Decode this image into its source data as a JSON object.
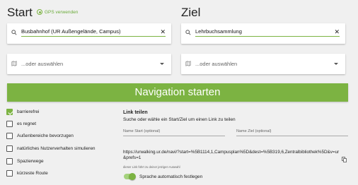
{
  "start": {
    "title": "Start",
    "gps_label": "GPS verwenden",
    "search_value": "Busbahnhof (UR Außengelände, Campus)",
    "search_clear": "✕",
    "select_value": "...oder auswählen"
  },
  "ziel": {
    "title": "Ziel",
    "search_value": "Lehrbuchsammlung",
    "search_clear": "✕",
    "select_value": "...oder auswählen"
  },
  "navigation_button": "Navigation starten",
  "options": [
    {
      "label": "barrierefrei",
      "checked": true
    },
    {
      "label": "es regnet",
      "checked": false
    },
    {
      "label": "Außenbereiche bevorzugen",
      "checked": false
    },
    {
      "label": "natürliches Nutzerverhalten simulieren",
      "checked": false
    },
    {
      "label": "Spazierwege",
      "checked": false
    },
    {
      "label": "kürzeste Route",
      "checked": false
    }
  ],
  "share": {
    "title": "Link teilen",
    "subtitle": "Suche oder wähle ein Start/Ziel um einen Link zu teilen",
    "name_start_placeholder": "Name Start (optional)",
    "name_ziel_placeholder": "Name Ziel (optional)",
    "link": "https://urwalking.ur.de/navi/?start=%5B1114,1,Campusplan%5D&dest=%5B319,6,Zentralbibliothek%5D&v=ur&prefs=1",
    "hint": "dieser Link führt zu deiner jetzigen Auswahl",
    "language_toggle_label": "Sprache automatisch festlegen",
    "language_toggle_on": true
  },
  "colors": {
    "accent": "#7cb342",
    "background": "#f0f0f0"
  }
}
